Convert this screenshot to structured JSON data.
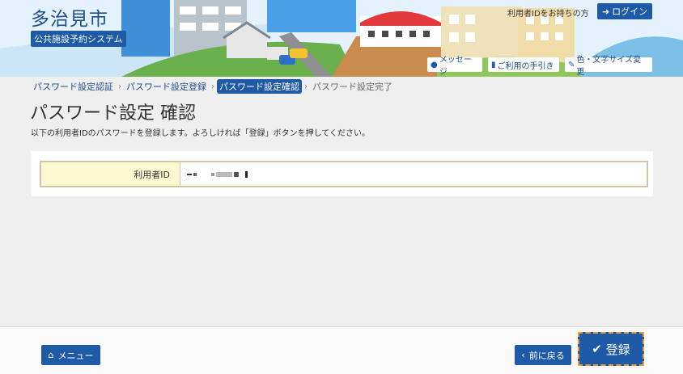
{
  "header": {
    "city_name": "多治見市",
    "system_name": "公共施設予約システム",
    "uid_note": "利用者IDをお持ちの方",
    "login_label": "ログイン",
    "links": {
      "message": "メッセージ",
      "guide": "ご利用の手引き",
      "display": "色・文字サイズ変更"
    }
  },
  "breadcrumb": {
    "step1": "パスワード設定認証",
    "step2": "パスワード設定登録",
    "step3": "パスワード設定確認",
    "step4": "パスワード設定完了"
  },
  "page": {
    "title": "パスワード設定 確認",
    "description": "以下の利用者IDのパスワードを登録します。よろしければ「登録」ボタンを押してください。"
  },
  "form": {
    "user_id_label": "利用者ID"
  },
  "footer": {
    "menu_label": "メニュー",
    "back_label": "前に戻る",
    "submit_label": "登録"
  },
  "colors": {
    "primary": "#1e5aa6",
    "label_bg": "#fdf7d2",
    "focus_outline": "#f0a030"
  }
}
